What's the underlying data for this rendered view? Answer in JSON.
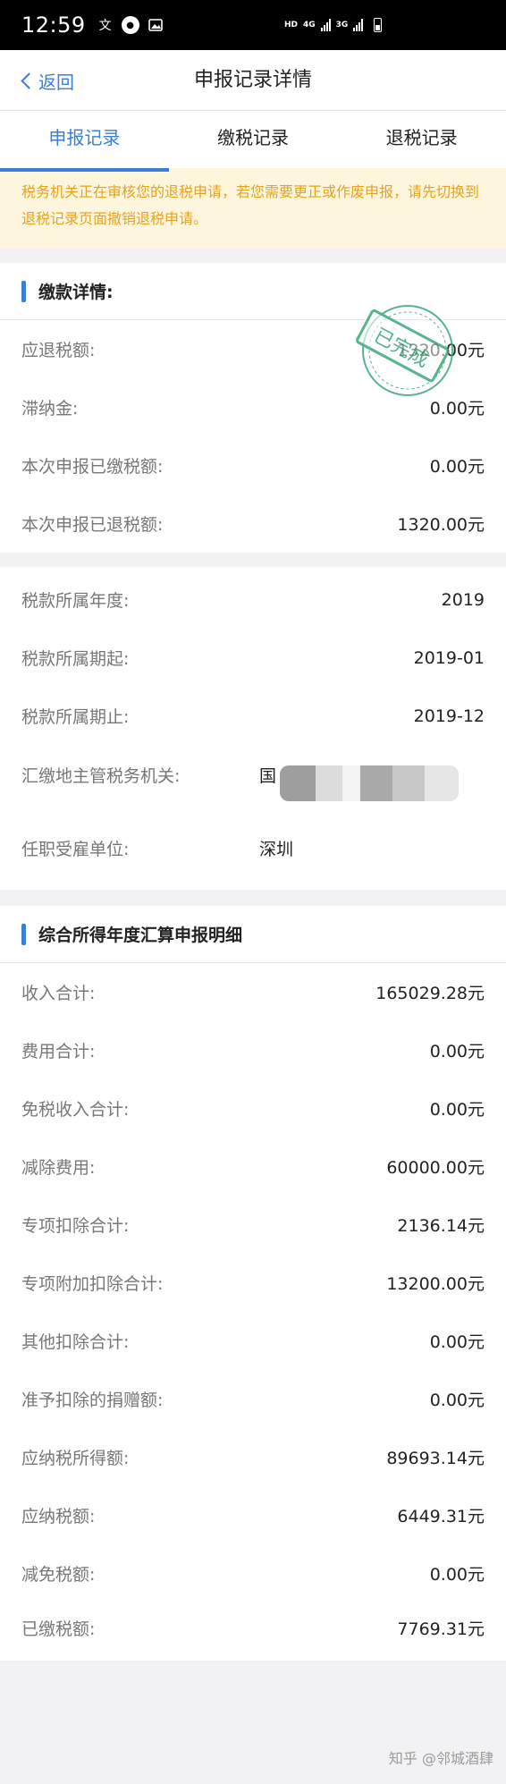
{
  "status_bar": {
    "time": "12:59",
    "network_hd": "HD",
    "network_4g": "4G",
    "network_3g": "3G"
  },
  "nav": {
    "back_label": "返回",
    "title": "申报记录详情"
  },
  "tabs": [
    {
      "label": "申报记录",
      "active": true
    },
    {
      "label": "缴税记录",
      "active": false
    },
    {
      "label": "退税记录",
      "active": false
    }
  ],
  "notice": "税务机关正在审核您的退税申请，若您需要更正或作废申报，请先切换到退税记录页面撤销退税申请。",
  "payment_section": {
    "title": "缴款详情:",
    "stamp_text": "已完成",
    "rows": [
      {
        "label": "应退税额:",
        "value": "1320.00元"
      },
      {
        "label": "滞纳金:",
        "value": "0.00元"
      },
      {
        "label": "本次申报已缴税额:",
        "value": "0.00元"
      },
      {
        "label": "本次申报已退税额:",
        "value": "1320.00元"
      }
    ]
  },
  "period_section": {
    "rows": [
      {
        "label": "税款所属年度:",
        "value": "2019"
      },
      {
        "label": "税款所属期起:",
        "value": "2019-01"
      },
      {
        "label": "税款所属期止:",
        "value": "2019-12"
      },
      {
        "label": "汇缴地主管税务机关:",
        "value": "国"
      },
      {
        "label": "任职受雇单位:",
        "value": "深圳"
      }
    ]
  },
  "detail_section": {
    "title": "综合所得年度汇算申报明细",
    "rows": [
      {
        "label": "收入合计:",
        "value": "165029.28元"
      },
      {
        "label": "费用合计:",
        "value": "0.00元"
      },
      {
        "label": "免税收入合计:",
        "value": "0.00元"
      },
      {
        "label": "减除费用:",
        "value": "60000.00元"
      },
      {
        "label": "专项扣除合计:",
        "value": "2136.14元"
      },
      {
        "label": "专项附加扣除合计:",
        "value": "13200.00元"
      },
      {
        "label": "其他扣除合计:",
        "value": "0.00元"
      },
      {
        "label": "准予扣除的捐赠额:",
        "value": "0.00元"
      },
      {
        "label": "应纳税所得额:",
        "value": "89693.14元"
      },
      {
        "label": "应纳税额:",
        "value": "6449.31元"
      },
      {
        "label": "减免税额:",
        "value": "0.00元"
      },
      {
        "label": "已缴税额:",
        "value": "7769.31元"
      }
    ]
  },
  "watermark": "知乎 @邻城酒肆",
  "colors": {
    "accent": "#3a7fd5",
    "notice_text": "#e7a21f",
    "notice_bg": "#fdf6dd",
    "stamp": "#3aa877"
  }
}
